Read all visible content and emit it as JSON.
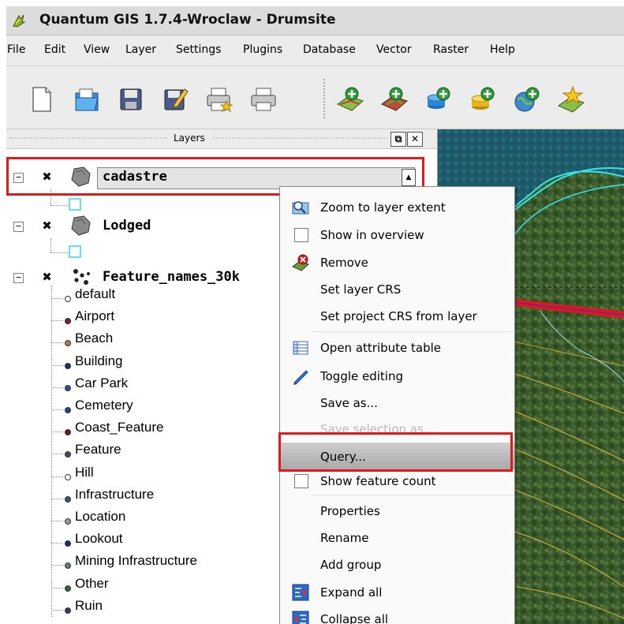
{
  "window": {
    "title": "Quantum GIS 1.7.4-Wroclaw - Drumsite",
    "app_icon": "qgis-logo-icon"
  },
  "menubar": {
    "items": [
      "File",
      "Edit",
      "View",
      "Layer",
      "Settings",
      "Plugins",
      "Database",
      "Vector",
      "Raster",
      "Help"
    ]
  },
  "toolbar": {
    "buttons": [
      "new-project-icon",
      "open-project-icon",
      "save-project-icon",
      "save-as-icon",
      "new-print-composer-icon",
      "print-composer-manager-icon",
      "add-vector-layer-icon",
      "add-raster-layer-icon",
      "add-postgis-layer-icon",
      "add-spatialite-layer-icon",
      "add-wms-layer-icon",
      "add-wfs-layer-icon"
    ]
  },
  "layers_panel": {
    "title": "Layers",
    "layers": [
      {
        "name": "cadastre",
        "checked": true,
        "expanded": true
      },
      {
        "name": "Lodged",
        "checked": true,
        "expanded": true
      },
      {
        "name": "Feature_names_30k",
        "checked": true,
        "expanded": true
      }
    ],
    "categories": [
      {
        "label": "default",
        "color": "#ffffff"
      },
      {
        "label": "Airport",
        "color": "#7a1f3a"
      },
      {
        "label": "Beach",
        "color": "#b07a5a"
      },
      {
        "label": "Building",
        "color": "#1f2f6a"
      },
      {
        "label": "Car Park",
        "color": "#2a4f8f"
      },
      {
        "label": "Cemetery",
        "color": "#2a3f9a"
      },
      {
        "label": "Coast_Feature",
        "color": "#6a1a1a"
      },
      {
        "label": "Feature",
        "color": "#3a4a7a"
      },
      {
        "label": "Hill",
        "color": "#ffffff"
      },
      {
        "label": "Infrastructure",
        "color": "#2a5a6a"
      },
      {
        "label": "Location",
        "color": "#9a9a9a"
      },
      {
        "label": "Lookout",
        "color": "#1a2a6a"
      },
      {
        "label": "Mining Infrastructure",
        "color": "#6a7a8a"
      },
      {
        "label": "Other",
        "color": "#2a6a3a"
      },
      {
        "label": "Ruin",
        "color": "#3a3a6a"
      }
    ]
  },
  "context_menu": {
    "items": [
      {
        "label": "Zoom to layer extent",
        "icon": "zoom-to-layer-icon",
        "enabled": true
      },
      {
        "label": "Show in overview",
        "icon": "checkbox-icon",
        "enabled": true
      },
      {
        "label": "Remove",
        "icon": "remove-layer-icon",
        "enabled": true
      },
      {
        "label": "Set layer CRS",
        "icon": "",
        "enabled": true
      },
      {
        "label": "Set project CRS from layer",
        "icon": "",
        "enabled": true
      },
      {
        "label": "Open attribute table",
        "icon": "attribute-table-icon",
        "enabled": true
      },
      {
        "label": "Toggle editing",
        "icon": "pencil-icon",
        "enabled": true
      },
      {
        "label": "Save as...",
        "icon": "",
        "enabled": true
      },
      {
        "label": "Save selection as...",
        "icon": "",
        "enabled": false
      },
      {
        "label": "Query...",
        "icon": "",
        "enabled": true,
        "highlighted": true
      },
      {
        "label": "Show feature count",
        "icon": "checkbox-icon",
        "enabled": true
      },
      {
        "label": "Properties",
        "icon": "",
        "enabled": true
      },
      {
        "label": "Rename",
        "icon": "",
        "enabled": true
      },
      {
        "label": "Add group",
        "icon": "",
        "enabled": true
      },
      {
        "label": "Expand all",
        "icon": "expand-all-icon",
        "enabled": true
      },
      {
        "label": "Collapse all",
        "icon": "collapse-all-icon",
        "enabled": true
      }
    ]
  },
  "colors": {
    "highlight_outline": "#e01b1b",
    "map_background": "#3f5b2f",
    "coastline": "#36e6ee",
    "road": "#e01818",
    "contours": "#b8a63a"
  }
}
